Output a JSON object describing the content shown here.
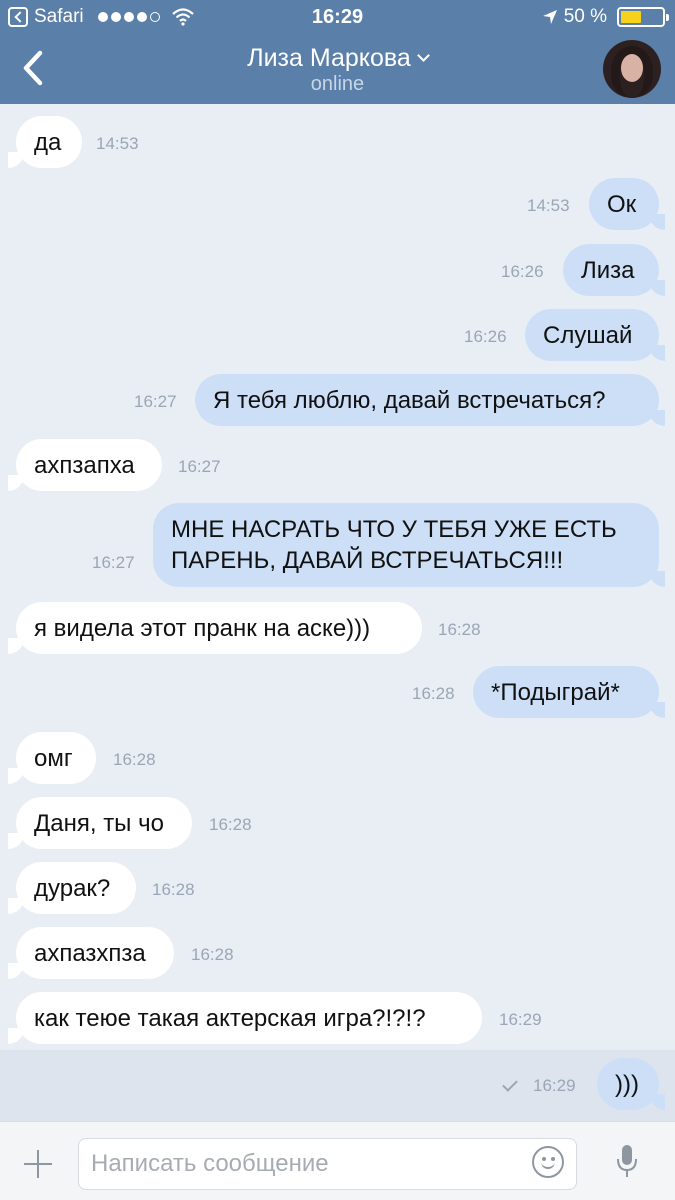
{
  "status_bar": {
    "carrier": "Safari",
    "time": "16:29",
    "battery": "50 %",
    "battery_level": 0.5
  },
  "nav": {
    "title": "Лиза Маркова",
    "subtitle": "online"
  },
  "messages": [
    {
      "dir": "in",
      "text": "да",
      "time": "14:53"
    },
    {
      "dir": "out",
      "text": "Ок",
      "time": "14:53"
    },
    {
      "dir": "out",
      "text": "Лиза",
      "time": "16:26"
    },
    {
      "dir": "out",
      "text": "Слушай",
      "time": "16:26"
    },
    {
      "dir": "out",
      "text": "Я тебя люблю, давай встречаться?",
      "time": "16:27"
    },
    {
      "dir": "in",
      "text": "ахпзапха",
      "time": "16:27"
    },
    {
      "dir": "out",
      "text": "МНЕ НАСРАТЬ ЧТО У ТЕБЯ УЖЕ ЕСТЬ ПАРЕНЬ, ДАВАЙ ВСТРЕЧАТЬСЯ!!!",
      "time": "16:27"
    },
    {
      "dir": "in",
      "text": "я видела этот пранк на аске)))",
      "time": "16:28"
    },
    {
      "dir": "out",
      "text": "*Подыграй*",
      "time": "16:28"
    },
    {
      "dir": "in",
      "text": "омг",
      "time": "16:28"
    },
    {
      "dir": "in",
      "text": "Даня, ты чо",
      "time": "16:28"
    },
    {
      "dir": "in",
      "text": "дурак?",
      "time": "16:28"
    },
    {
      "dir": "in",
      "text": "ахпазхпза",
      "time": "16:28"
    },
    {
      "dir": "in",
      "text": "как теюе такая актерская игра?!?!?",
      "time": "16:29"
    },
    {
      "dir": "out",
      "text": ")))",
      "time": "16:29"
    }
  ],
  "composer": {
    "placeholder": "Написать сообщение"
  },
  "colors": {
    "header": "#5a7fa8",
    "incoming_bubble": "#ffffff",
    "outgoing_bubble": "#cddff7",
    "background": "#e9eef5"
  }
}
